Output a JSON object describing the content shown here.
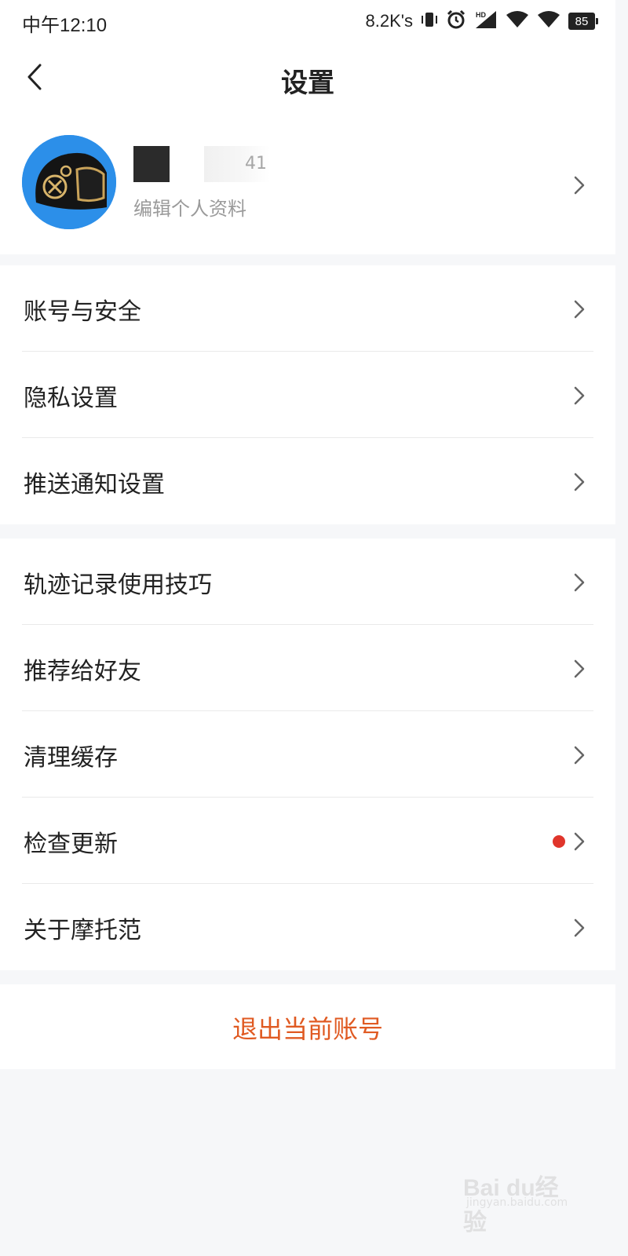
{
  "status_bar": {
    "time": "中午12:10",
    "net_speed": "8.2K's",
    "battery": "85",
    "icons": [
      "vibrate-icon",
      "alarm-icon",
      "hd-signal-icon",
      "wifi-icon",
      "wifi-icon",
      "battery-icon"
    ]
  },
  "nav": {
    "title": "设置",
    "back_icon": "chevron-left-icon"
  },
  "profile": {
    "name_fragment": "41",
    "subtitle": "编辑个人资料"
  },
  "group_1": [
    {
      "label": "账号与安全"
    },
    {
      "label": "隐私设置"
    },
    {
      "label": "推送通知设置"
    }
  ],
  "group_2": [
    {
      "label": "轨迹记录使用技巧"
    },
    {
      "label": "推荐给好友"
    },
    {
      "label": "清理缓存"
    },
    {
      "label": "检查更新",
      "badge": "red-dot"
    },
    {
      "label": "关于摩托范"
    }
  ],
  "logout": {
    "label": "退出当前账号"
  },
  "colors": {
    "logout_text": "#e05a22",
    "badge": "#e0352b",
    "avatar_bg": "#2c8fe9",
    "page_bg": "#f6f7f9"
  },
  "watermark": {
    "text": "Bai du经验",
    "url": "jingyan.baidu.com"
  }
}
